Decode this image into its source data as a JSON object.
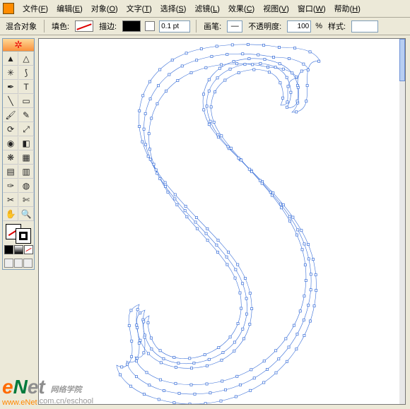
{
  "menu": {
    "items": [
      {
        "label": "文件",
        "accel": "F"
      },
      {
        "label": "编辑",
        "accel": "E"
      },
      {
        "label": "对象",
        "accel": "O"
      },
      {
        "label": "文字",
        "accel": "T"
      },
      {
        "label": "选择",
        "accel": "S"
      },
      {
        "label": "滤镜",
        "accel": "L"
      },
      {
        "label": "效果",
        "accel": "C"
      },
      {
        "label": "视图",
        "accel": "V"
      },
      {
        "label": "窗口",
        "accel": "W"
      },
      {
        "label": "帮助",
        "accel": "H"
      }
    ]
  },
  "options": {
    "mode_label": "混合对象",
    "fill_label": "填色:",
    "stroke_label": "描边:",
    "stroke_weight": "0.1 pt",
    "brush_label": "画笔:",
    "opacity_label": "不透明度:",
    "opacity_value": "100",
    "opacity_suffix": "%",
    "style_label": "样式:"
  },
  "tools": [
    {
      "name": "selection-tool",
      "glyph": "▲"
    },
    {
      "name": "direct-selection-tool",
      "glyph": "△"
    },
    {
      "name": "magic-wand-tool",
      "glyph": "✳"
    },
    {
      "name": "lasso-tool",
      "glyph": "⟆"
    },
    {
      "name": "pen-tool",
      "glyph": "✒"
    },
    {
      "name": "type-tool",
      "glyph": "T"
    },
    {
      "name": "line-tool",
      "glyph": "╲"
    },
    {
      "name": "rectangle-tool",
      "glyph": "▭"
    },
    {
      "name": "paintbrush-tool",
      "glyph": "🖌"
    },
    {
      "name": "pencil-tool",
      "glyph": "✎"
    },
    {
      "name": "rotate-tool",
      "glyph": "⟳"
    },
    {
      "name": "scale-tool",
      "glyph": "⤢"
    },
    {
      "name": "warp-tool",
      "glyph": "◉"
    },
    {
      "name": "free-transform-tool",
      "glyph": "◧"
    },
    {
      "name": "symbol-sprayer-tool",
      "glyph": "❋"
    },
    {
      "name": "graph-tool",
      "glyph": "▦"
    },
    {
      "name": "mesh-tool",
      "glyph": "▤"
    },
    {
      "name": "gradient-tool",
      "glyph": "▥"
    },
    {
      "name": "eyedropper-tool",
      "glyph": "✑"
    },
    {
      "name": "blend-tool",
      "glyph": "◍"
    },
    {
      "name": "slice-tool",
      "glyph": "✂"
    },
    {
      "name": "scissors-tool",
      "glyph": "✄"
    },
    {
      "name": "hand-tool",
      "glyph": "✋"
    },
    {
      "name": "zoom-tool",
      "glyph": "🔍"
    }
  ],
  "watermark": {
    "logo_e": "e",
    "logo_n": "N",
    "logo_et": "et",
    "sub": "网络学院",
    "url": "www.eNet",
    "url2": ".com.cn",
    "url3": "/eschool"
  }
}
